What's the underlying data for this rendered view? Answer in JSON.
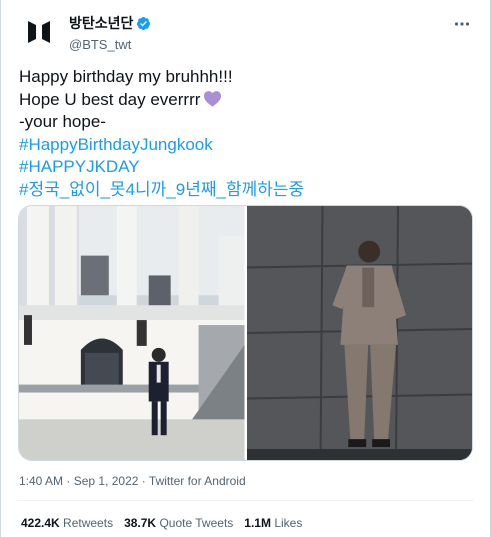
{
  "author": {
    "display_name": "방탄소년단",
    "handle": "@BTS_twt",
    "verified": true,
    "avatar_icon": "bts-logo-icon",
    "verified_color": "#1d9bf0"
  },
  "tweet": {
    "lines": [
      "Happy birthday my bruhhh!!!",
      "Hope U best day everrrr",
      "-your hope-"
    ],
    "emoji": "purple-heart-icon",
    "hashtags": [
      "#HappyBirthdayJungkook",
      "#HAPPYJKDAY",
      "#정국_없이_못4니까_9년째_함께하는중"
    ],
    "link_color": "#1d9bf0"
  },
  "meta": {
    "time": "1:40 AM",
    "separator": "·",
    "date": "Sep 1, 2022",
    "source": "Twitter for Android"
  },
  "stats": {
    "retweets_count": "422.4K",
    "retweets_label": "Retweets",
    "quote_count": "38.7K",
    "quote_label": "Quote Tweets",
    "likes_count": "1.1M",
    "likes_label": "Likes"
  }
}
